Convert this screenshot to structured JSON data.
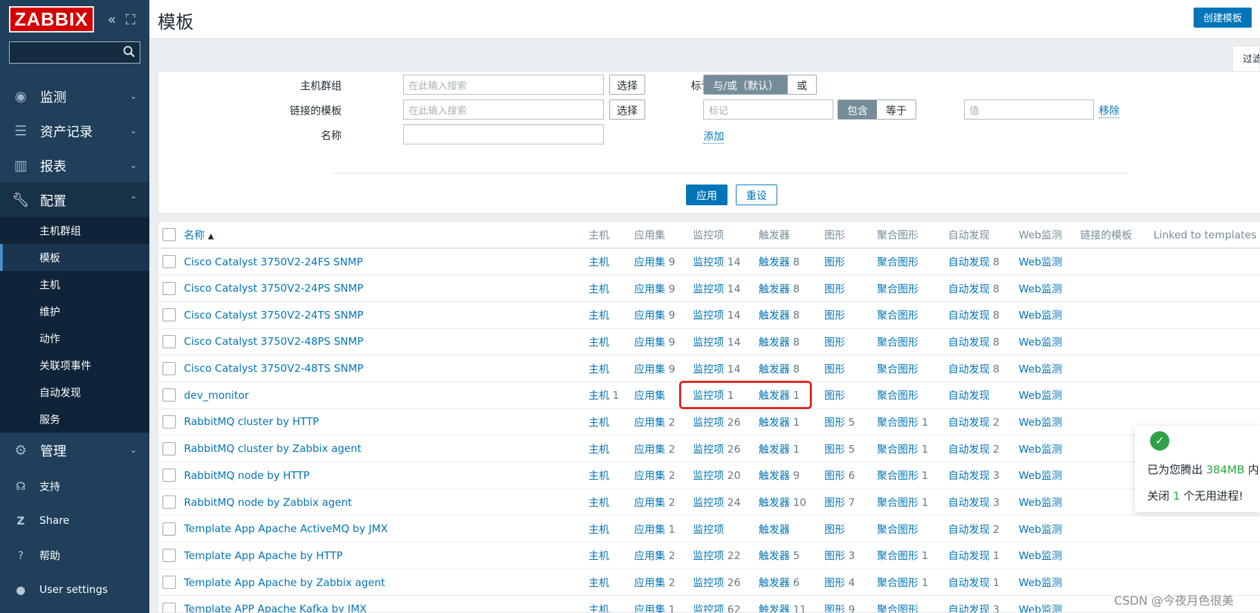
{
  "logo": "ZABBIX",
  "sidebar": {
    "menu": [
      {
        "label": "监测",
        "icon": "eye-icon"
      },
      {
        "label": "资产记录",
        "icon": "list-icon"
      },
      {
        "label": "报表",
        "icon": "bar-chart-icon"
      },
      {
        "label": "配置",
        "icon": "wrench-icon"
      }
    ],
    "config_sub": [
      "主机群组",
      "模板",
      "主机",
      "维护",
      "动作",
      "关联项事件",
      "自动发现",
      "服务"
    ],
    "admin": {
      "label": "管理",
      "icon": "gear-icon"
    },
    "bottom": [
      {
        "label": "支持",
        "icon": "headset-icon"
      },
      {
        "label": "Share",
        "icon": "zabbix-share-icon"
      },
      {
        "label": "帮助",
        "icon": "question-icon"
      },
      {
        "label": "User settings",
        "icon": "user-icon"
      }
    ]
  },
  "header": {
    "title": "模板",
    "create_button": "创建模板",
    "filter_tab": "过滤器"
  },
  "filter": {
    "host_group_label": "主机群组",
    "linked_templates_label": "链接的模板",
    "name_label": "名称",
    "search_placeholder": "在此输入搜索",
    "select_button": "选择",
    "tags_label": "标记",
    "and_or": "与/或（默认）",
    "or": "或",
    "tag_placeholder": "标记",
    "contains": "包含",
    "equals": "等于",
    "value_placeholder": "值",
    "remove": "移除",
    "add": "添加",
    "apply": "应用",
    "reset": "重设"
  },
  "table": {
    "headers": [
      "名称",
      "主机",
      "应用集",
      "监控项",
      "触发器",
      "图形",
      "聚合图形",
      "自动发现",
      "Web监测",
      "链接的模板",
      "Linked to templates"
    ],
    "link_labels": {
      "hosts": "主机",
      "apps": "应用集",
      "items": "监控项",
      "triggers": "触发器",
      "graphs": "图形",
      "screens": "聚合图形",
      "discovery": "自动发现",
      "web": "Web监测"
    },
    "rows": [
      {
        "name": "Cisco Catalyst 3750V2-24FS SNMP",
        "hosts": "",
        "apps": "9",
        "items": "14",
        "triggers": "8",
        "graphs": "",
        "screens": "",
        "discovery": "8"
      },
      {
        "name": "Cisco Catalyst 3750V2-24PS SNMP",
        "hosts": "",
        "apps": "9",
        "items": "14",
        "triggers": "8",
        "graphs": "",
        "screens": "",
        "discovery": "8"
      },
      {
        "name": "Cisco Catalyst 3750V2-24TS SNMP",
        "hosts": "",
        "apps": "9",
        "items": "14",
        "triggers": "8",
        "graphs": "",
        "screens": "",
        "discovery": "8"
      },
      {
        "name": "Cisco Catalyst 3750V2-48PS SNMP",
        "hosts": "",
        "apps": "9",
        "items": "14",
        "triggers": "8",
        "graphs": "",
        "screens": "",
        "discovery": "8"
      },
      {
        "name": "Cisco Catalyst 3750V2-48TS SNMP",
        "hosts": "",
        "apps": "9",
        "items": "14",
        "triggers": "8",
        "graphs": "",
        "screens": "",
        "discovery": "8"
      },
      {
        "name": "dev_monitor",
        "hosts": "1",
        "apps": "",
        "items": "1",
        "triggers": "1",
        "graphs": "",
        "screens": "",
        "discovery": ""
      },
      {
        "name": "RabbitMQ cluster by HTTP",
        "hosts": "",
        "apps": "2",
        "items": "26",
        "triggers": "1",
        "graphs": "5",
        "screens": "1",
        "discovery": "2"
      },
      {
        "name": "RabbitMQ cluster by Zabbix agent",
        "hosts": "",
        "apps": "2",
        "items": "26",
        "triggers": "1",
        "graphs": "5",
        "screens": "1",
        "discovery": "2"
      },
      {
        "name": "RabbitMQ node by HTTP",
        "hosts": "",
        "apps": "2",
        "items": "20",
        "triggers": "9",
        "graphs": "6",
        "screens": "1",
        "discovery": "3"
      },
      {
        "name": "RabbitMQ node by Zabbix agent",
        "hosts": "",
        "apps": "2",
        "items": "24",
        "triggers": "10",
        "graphs": "7",
        "screens": "1",
        "discovery": "3"
      },
      {
        "name": "Template App Apache ActiveMQ by JMX",
        "hosts": "",
        "apps": "1",
        "items": "",
        "triggers": "",
        "graphs": "",
        "screens": "",
        "discovery": "2"
      },
      {
        "name": "Template App Apache by HTTP",
        "hosts": "",
        "apps": "2",
        "items": "22",
        "triggers": "5",
        "graphs": "3",
        "screens": "1",
        "discovery": "1"
      },
      {
        "name": "Template App Apache by Zabbix agent",
        "hosts": "",
        "apps": "2",
        "items": "26",
        "triggers": "6",
        "graphs": "4",
        "screens": "1",
        "discovery": "1"
      },
      {
        "name": "Template APP Apache Kafka by JMX",
        "hosts": "",
        "apps": "1",
        "items": "62",
        "triggers": "11",
        "graphs": "9",
        "screens": "",
        "discovery": "3"
      }
    ]
  },
  "toast": {
    "line1_prefix": "已为您腾出 ",
    "line1_value": "384MB",
    "line1_suffix": " 内",
    "line2_prefix": "关闭 ",
    "line2_value": "1",
    "line2_suffix": " 个无用进程!"
  },
  "watermark": "CSDN @今夜月色很美"
}
